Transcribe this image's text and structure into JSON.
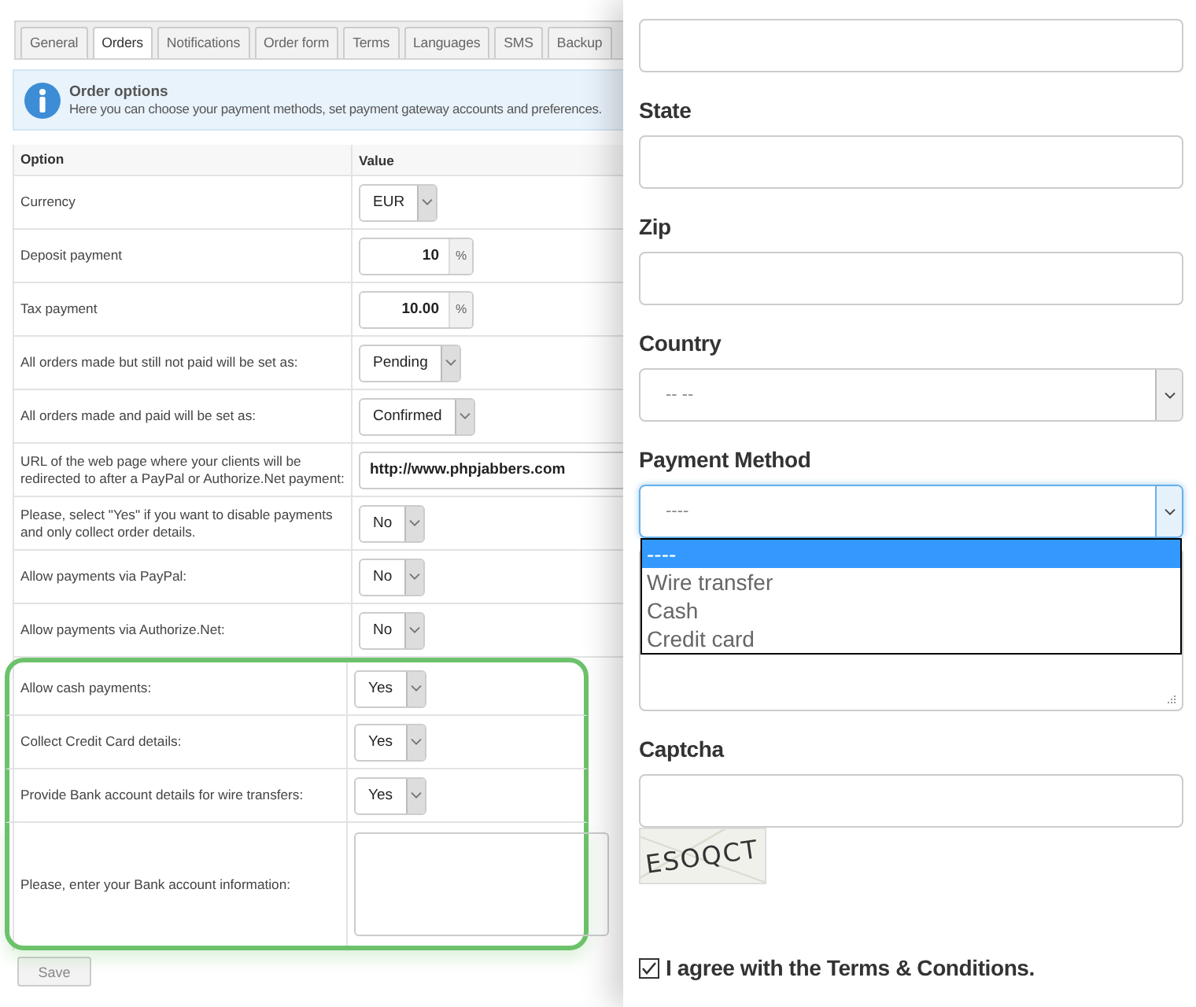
{
  "tabs": [
    {
      "label": "General",
      "selected": false
    },
    {
      "label": "Orders",
      "selected": true
    },
    {
      "label": "Notifications",
      "selected": false
    },
    {
      "label": "Order form",
      "selected": false
    },
    {
      "label": "Terms",
      "selected": false
    },
    {
      "label": "Languages",
      "selected": false
    },
    {
      "label": "SMS",
      "selected": false
    },
    {
      "label": "Backup",
      "selected": false
    }
  ],
  "info": {
    "title": "Order options",
    "text": "Here you can choose your payment methods, set payment gateway accounts and preferences."
  },
  "table": {
    "columns": [
      "Option",
      "Value"
    ],
    "rows": [
      {
        "label": "Currency",
        "kind": "select",
        "value": "EUR",
        "highlighted": false
      },
      {
        "label": "Deposit payment",
        "kind": "percent",
        "value": "10",
        "suffix": "%",
        "highlighted": false
      },
      {
        "label": "Tax payment",
        "kind": "percent",
        "value": "10.00",
        "suffix": "%",
        "highlighted": false
      },
      {
        "label": "All orders made but still not paid will be set as:",
        "kind": "select",
        "value": "Pending",
        "highlighted": false
      },
      {
        "label": "All orders made and paid will be set as:",
        "kind": "select",
        "value": "Confirmed",
        "highlighted": false
      },
      {
        "label": "URL of the web page where your clients will be redirected to after a PayPal or Authorize.Net payment:",
        "kind": "text",
        "value": "http://www.phpjabbers.com",
        "highlighted": false
      },
      {
        "label": "Please, select \"Yes\" if you want to disable payments and only collect order details.",
        "kind": "select",
        "value": "No",
        "highlighted": false
      },
      {
        "label": "Allow payments via PayPal:",
        "kind": "select",
        "value": "No",
        "highlighted": false
      },
      {
        "label": "Allow payments via Authorize.Net:",
        "kind": "select",
        "value": "No",
        "highlighted": false
      },
      {
        "label": "Allow cash payments:",
        "kind": "select",
        "value": "Yes",
        "highlighted": true
      },
      {
        "label": "Collect Credit Card details:",
        "kind": "select",
        "value": "Yes",
        "highlighted": true
      },
      {
        "label": "Provide Bank account details for wire transfers:",
        "kind": "select",
        "value": "Yes",
        "highlighted": true
      },
      {
        "label": "Please, enter your Bank account information:",
        "kind": "textarea",
        "highlighted": true
      }
    ]
  },
  "save_button": "Save",
  "form": {
    "fields": [
      {
        "kind": "input"
      },
      {
        "kind": "input",
        "label": "State"
      },
      {
        "kind": "input",
        "label": "Zip"
      },
      {
        "kind": "select",
        "label": "Country",
        "value": "-- --",
        "expanded": false
      },
      {
        "kind": "select",
        "label": "Payment Method",
        "value": "----",
        "expanded": true,
        "options": [
          {
            "label": "----",
            "selected": true
          },
          {
            "label": "Wire transfer",
            "selected": false
          },
          {
            "label": "Cash",
            "selected": false
          },
          {
            "label": "Credit card",
            "selected": false
          }
        ]
      },
      {
        "kind": "textarea"
      },
      {
        "kind": "input",
        "label": "Captcha"
      },
      {
        "kind": "captcha",
        "value": "ESOQCT"
      }
    ],
    "terms": {
      "label": "I agree with the Terms & Conditions.",
      "checked": true
    }
  }
}
